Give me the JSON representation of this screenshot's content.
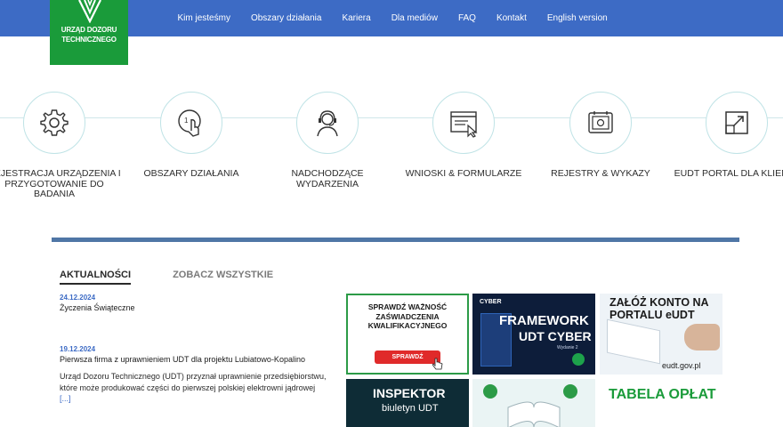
{
  "logo": {
    "line1": "URZĄD DOZORU",
    "line2": "TECHNICZNEGO"
  },
  "nav": [
    "Kim jesteśmy",
    "Obszary działania",
    "Kariera",
    "Dla mediów",
    "FAQ",
    "Kontakt",
    "English version"
  ],
  "tiles": [
    {
      "label": "REJESTRACJA URZĄDZENIA I PRZYGOTOWANIE DO BADANIA",
      "icon": "gear-icon"
    },
    {
      "label": "OBSZARY DZIAŁANIA",
      "icon": "touch-index-icon"
    },
    {
      "label": "NADCHODZĄCE WYDARZENIA",
      "icon": "headset-person-icon"
    },
    {
      "label": "WNIOSKI & FORMULARZE",
      "icon": "browser-form-icon"
    },
    {
      "label": "REJESTRY & WYKAZY",
      "icon": "register-book-icon"
    },
    {
      "label": "EUDT PORTAL DLA KLIENTA",
      "icon": "external-link-icon"
    }
  ],
  "news": {
    "tab_active": "AKTUALNOŚCI",
    "tab_all": "ZOBACZ WSZYSTKIE",
    "items": [
      {
        "date": "24.12.2024",
        "title": "Życzenia Świąteczne"
      },
      {
        "date": "19.12.2024",
        "title": "Pierwsza firma z uprawnieniem UDT dla projektu Lubiatowo-Kopalino",
        "excerpt": "Urząd Dozoru Technicznego (UDT) przyznał uprawnienie przedsiębiorstwu, które może produkować części do pierwszej polskiej elektrowni jądrowej",
        "more": "[...]"
      }
    ]
  },
  "banners": {
    "check": {
      "text": "SPRAWDŹ WAŻNOŚĆ ZAŚWIADCZENIA KWALIFIKACYJNEGO",
      "button": "SPRAWDŹ"
    },
    "cyber": {
      "tag": "CYBER",
      "title1": "FRAMEWORK",
      "title2": "UDT CYBER",
      "edition": "Wydanie 2"
    },
    "eudt": {
      "title": "ZAŁÓŻ KONTO NA PORTALU eUDT",
      "url": "eudt.gov.pl"
    },
    "inspektor": {
      "title": "INSPEKTOR",
      "subtitle": "biuletyn UDT"
    },
    "fees": {
      "title": "TABELA OPŁAT"
    }
  },
  "colors": {
    "nav_bg": "#3d6bc5",
    "logo_bg": "#1a9b3a",
    "divider": "#4f76a6",
    "date": "#3d6bc5"
  }
}
